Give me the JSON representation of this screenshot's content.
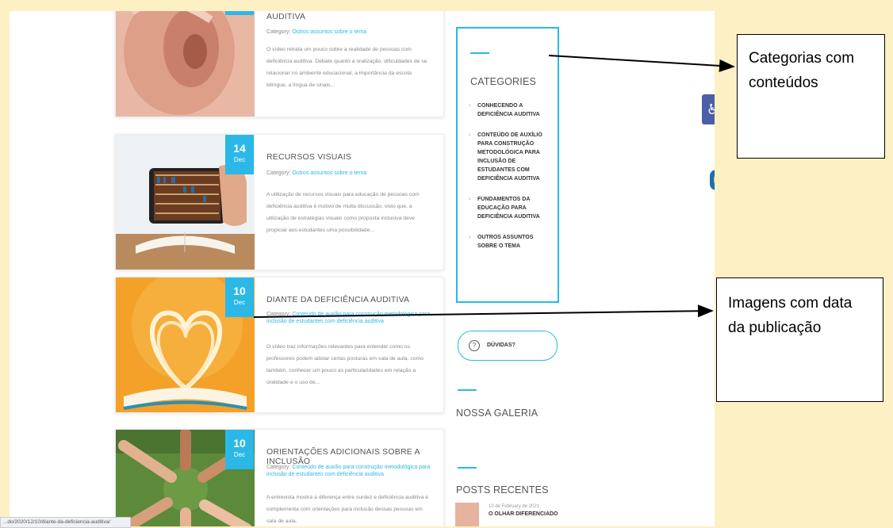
{
  "posts": [
    {
      "title": "AUDITIVA",
      "category_label": "Category:",
      "category": "Outros assuntos sobre o tema",
      "excerpt": "O vídeo retrata um pouco sobre a realidade de pessoas com deficiência auditiva. Debate quanto a oralização, dificuldades de se relacionar no ambiente educacional, a importância da escola bilíngue, a língua de sinais..."
    },
    {
      "day": "14",
      "month": "Dec",
      "title": "RECURSOS VISUAIS",
      "category_label": "Category:",
      "category": "Outros assuntos sobre o tema",
      "excerpt": "A utilização de recursos visuais para educação de pessoas com deficiência auditiva é motivo de muita discussão, visto que, a utilização de estratégias visuais como proposta inclusiva deve propiciar aos estudantes uma possibilidade..."
    },
    {
      "day": "10",
      "month": "Dec",
      "title": "DIANTE DA DEFICIÊNCIA AUDITIVA",
      "category_label": "Category:",
      "category": "Conteúdo de auxílio para construção metodológica para inclusão de estudantes com deficiência auditiva",
      "excerpt": "O vídeo traz informações relevantes para entender como os professores podem adotar certas posturas em sala de aula, como também, conhecer um pouco as particularidades em relação a oralidade e o uso de..."
    },
    {
      "day": "10",
      "month": "Dec",
      "title": "ORIENTAÇÕES ADICIONAIS SOBRE A INCLUSÃO",
      "category_label": "Category:",
      "category": "Conteúdo de auxílio para construção metodológica para inclusão de estudantes com deficiência auditiva",
      "excerpt": "A entrevista mostra a diferença entre surdez e deficiência auditiva e complementa com orientações para inclusão dessas pessoas em sala de aula."
    }
  ],
  "sidebar": {
    "categories_title": "CATEGORIES",
    "categories": [
      "CONHECENDO A DEFICIÊNCIA AUDITIVA",
      "CONTEÚDO DE AUXÍLIO PARA CONSTRUÇÃO METODOLÓGICA PARA INCLUSÃO DE ESTUDANTES COM DEFICIÊNCIA AUDITIVA",
      "FUNDAMENTOS DA EDUCAÇÃO PARA DEFICIÊNCIA AUDITIVA",
      "OUTROS ASSUNTOS SOBRE O TEMA"
    ],
    "duvidas_label": "DÚVIDAS?",
    "gallery_title": "NOSSA GALERIA",
    "recent_title": "POSTS RECENTES",
    "recent_date": "10 de February de 2021",
    "recent_post": "O OLHAR DIFERENCIADO"
  },
  "annotations": {
    "categorias": "Categorias com conteúdos",
    "imagens": "Imagens com data da publicação"
  },
  "status_url": "...do/2020/12/10/diante-da-deficiencia-auditiva/",
  "colors": {
    "accent": "#2bb8e6",
    "background": "#fdf0c4",
    "access_button": "#4a5fa8"
  },
  "icons": [
    "wheelchair-icon",
    "hand-libras-icon",
    "question-icon",
    "chevron-right-icon"
  ]
}
